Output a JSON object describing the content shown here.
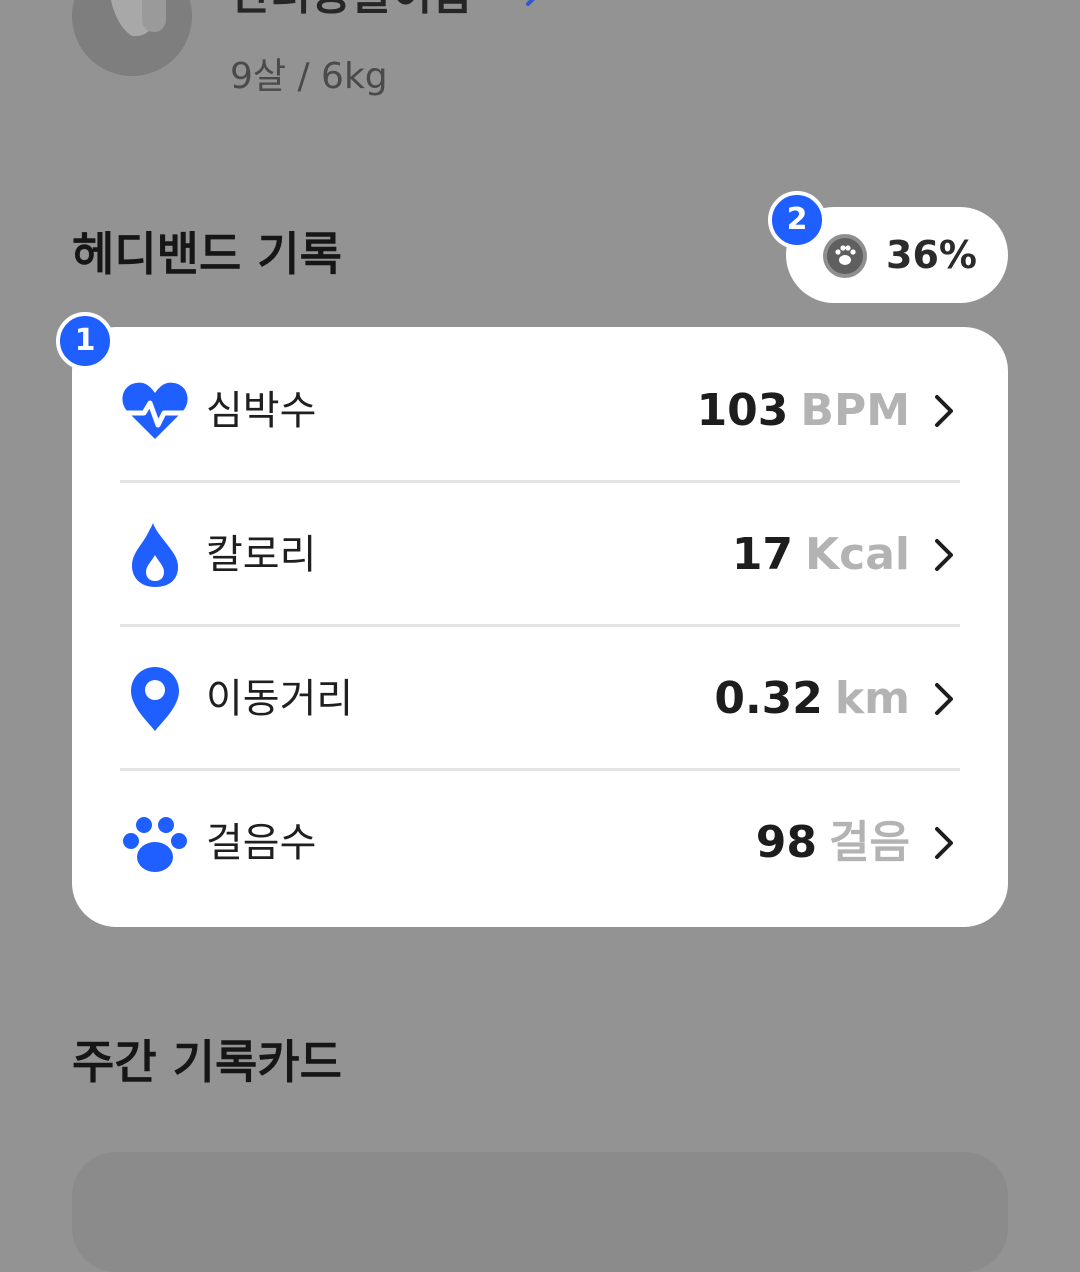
{
  "profile": {
    "name": "반려동물이름",
    "info": "9살 / 6kg"
  },
  "headband": {
    "title": "헤디밴드 기록",
    "battery": "36%",
    "records": [
      {
        "label": "심박수",
        "value": "103",
        "unit": "BPM",
        "icon": "heart-pulse-icon"
      },
      {
        "label": "칼로리",
        "value": "17",
        "unit": "Kcal",
        "icon": "flame-icon"
      },
      {
        "label": "이동거리",
        "value": "0.32",
        "unit": "km",
        "icon": "location-pin-icon"
      },
      {
        "label": "걸음수",
        "value": "98",
        "unit": "걸음",
        "icon": "paw-icon"
      }
    ]
  },
  "weekly": {
    "title": "주간 기록카드"
  },
  "badges": {
    "first": "1",
    "second": "2"
  },
  "colors": {
    "accent": "#1f5fff",
    "overlay": "#939393",
    "card": "#ffffff",
    "unit": "#b3b3b3"
  }
}
